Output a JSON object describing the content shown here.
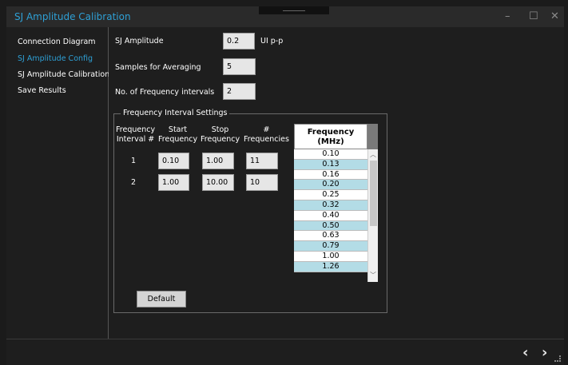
{
  "window": {
    "title": "SJ Amplitude Calibration",
    "controls": {
      "minimize": "–",
      "maximize": "☐",
      "close": "✕"
    }
  },
  "sidebar": {
    "items": [
      {
        "label": "Connection Diagram",
        "active": false
      },
      {
        "label": "SJ Amplitude Config",
        "active": true
      },
      {
        "label": "SJ Amplitude Calibration",
        "active": false
      },
      {
        "label": "Save Results",
        "active": false
      }
    ]
  },
  "config": {
    "sj_amplitude": {
      "label": "SJ Amplitude",
      "value": "0.2",
      "unit": "UI p-p"
    },
    "samples": {
      "label": "Samples for Averaging",
      "value": "5"
    },
    "intervals": {
      "label": "No. of Frequency intervals",
      "value": "2"
    }
  },
  "interval_settings": {
    "title": "Frequency Interval Settings",
    "headers": {
      "interval": "Frequency\nInterval #",
      "start": "Start\nFrequency",
      "stop": "Stop\nFrequency",
      "count": "#\nFrequencies"
    },
    "rows": [
      {
        "interval": "1",
        "start": "0.10",
        "stop": "1.00",
        "count": "11"
      },
      {
        "interval": "2",
        "start": "1.00",
        "stop": "10.00",
        "count": "10"
      }
    ],
    "default_button": "Default"
  },
  "frequency_table": {
    "header": "Frequency\n(MHz)",
    "values": [
      "0.10",
      "0.13",
      "0.16",
      "0.20",
      "0.25",
      "0.32",
      "0.40",
      "0.50",
      "0.63",
      "0.79",
      "1.00",
      "1.26"
    ]
  },
  "footer": {
    "prev": "‹",
    "next": "›"
  },
  "colors": {
    "accent": "#2ea0d6",
    "row_alt": "#b3dce6"
  }
}
